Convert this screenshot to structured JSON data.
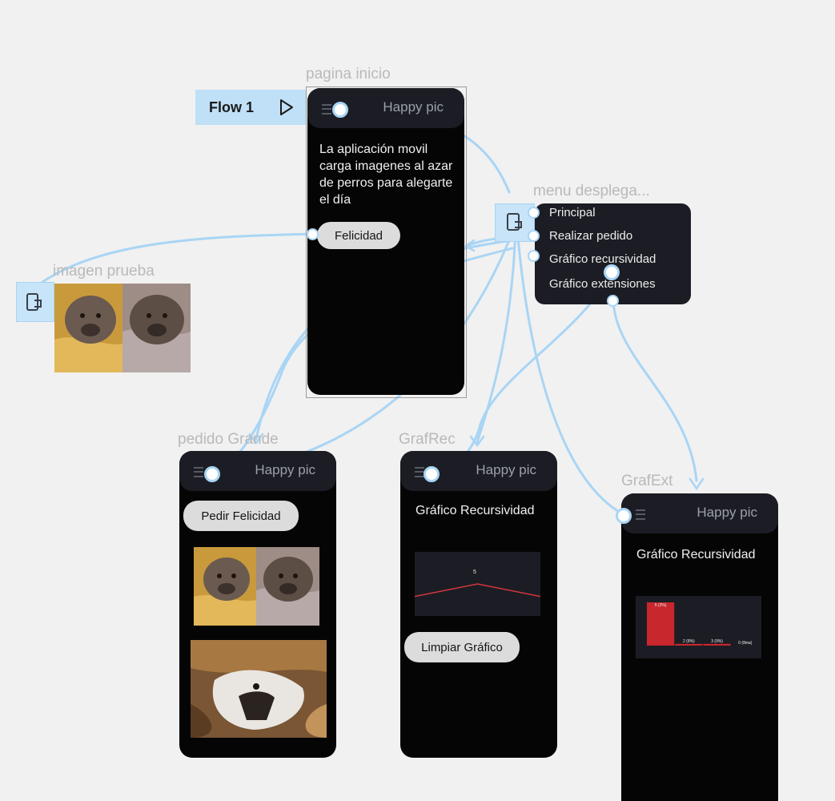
{
  "flow": {
    "label": "Flow 1"
  },
  "frames": {
    "inicio": {
      "label": "pagina inicio",
      "header_title": "Happy pic",
      "description": "La aplicación movil carga imagenes al azar de perros para alegarte el día",
      "button": "Felicidad"
    },
    "menu": {
      "label": "menu desplega...",
      "items": [
        "Principal",
        "Realizar pedido",
        "Gráfico recursividad",
        "Gráfico extensiones"
      ]
    },
    "imagen": {
      "label": "imagen prueba"
    },
    "pedido": {
      "label": "pedido Grande",
      "header_title": "Happy pic",
      "button": "Pedir Felicidad"
    },
    "grafrec": {
      "label": "GrafRec",
      "header_title": "Happy pic",
      "chart_title": "Gráfico Recursividad",
      "button": "Limpiar Gráfico",
      "chart_label": "5"
    },
    "grafext": {
      "label": "GrafExt",
      "header_title": "Happy pic",
      "chart_title": "Gráfico Recursividad",
      "bar_labels": [
        "5 (2%)",
        "2 (8%)",
        "3 (9%)",
        "0 (8ma)"
      ]
    }
  },
  "colors": {
    "canvas": "#f1f1f1",
    "phone": "#050505",
    "header": "#1c1d24",
    "connector": "#a9d5f5",
    "flow_tag": "#bfe0f7",
    "chart_line": "#d3363e",
    "chart_bar": "#c7272d"
  },
  "chart_data": [
    {
      "type": "line",
      "title": "Gráfico Recursividad",
      "series": [
        {
          "values": [
            2,
            5,
            2
          ]
        }
      ],
      "data_labels": [
        "5"
      ]
    },
    {
      "type": "bar",
      "title": "Gráfico Recursividad",
      "categories": [
        "5 (2%)",
        "2 (8%)",
        "3 (9%)",
        "0 (8ma)"
      ],
      "values": [
        5,
        0.2,
        0.2,
        0
      ]
    }
  ]
}
